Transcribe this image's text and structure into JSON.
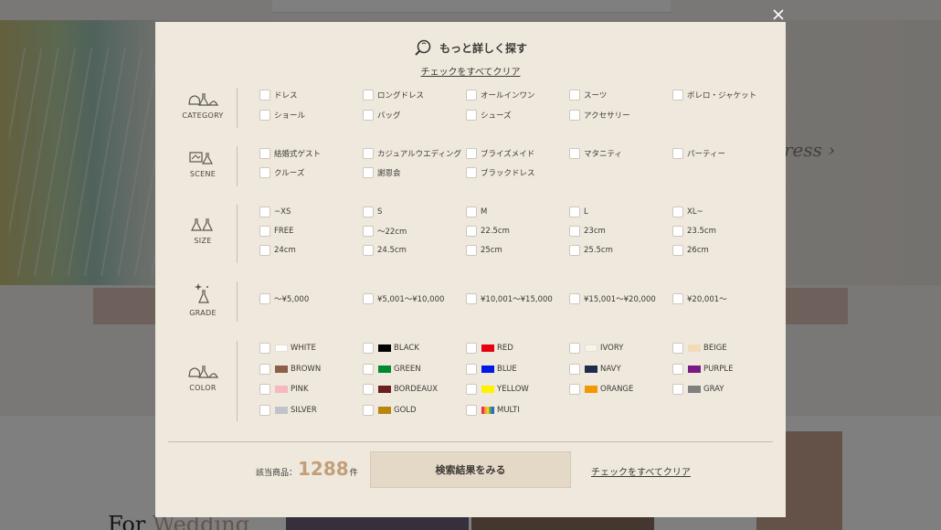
{
  "title": "もっと詳しく探す",
  "clear_all": "チェックをすべてクリア",
  "sections": {
    "category": {
      "label": "CATEGORY",
      "options": [
        "ドレス",
        "ロングドレス",
        "オールインワン",
        "スーツ",
        "ボレロ・ジャケット",
        "ショール",
        "バッグ",
        "シューズ",
        "アクセサリー"
      ]
    },
    "scene": {
      "label": "SCENE",
      "options": [
        "結婚式ゲスト",
        "カジュアルウエディング",
        "ブライズメイド",
        "マタニティ",
        "パーティー",
        "クルーズ",
        "謝恩会",
        "ブラックドレス"
      ]
    },
    "size": {
      "label": "SIZE",
      "options": [
        "~XS",
        "S",
        "M",
        "L",
        "XL~",
        "FREE",
        "～22cm",
        "22.5cm",
        "23cm",
        "23.5cm",
        "24cm",
        "24.5cm",
        "25cm",
        "25.5cm",
        "26cm"
      ]
    },
    "grade": {
      "label": "GRADE",
      "options": [
        "～¥5,000",
        "¥5,001～¥10,000",
        "¥10,001～¥15,000",
        "¥15,001～¥20,000",
        "¥20,001～"
      ]
    },
    "color": {
      "label": "COLOR",
      "options": [
        {
          "label": "WHITE",
          "color": "#ffffff"
        },
        {
          "label": "BLACK",
          "color": "#000000"
        },
        {
          "label": "RED",
          "color": "#e60012"
        },
        {
          "label": "IVORY",
          "color": "#f8f4e8"
        },
        {
          "label": "BEIGE",
          "color": "#f1dbb8"
        },
        {
          "label": "BROWN",
          "color": "#8b6046"
        },
        {
          "label": "GREEN",
          "color": "#008a2e"
        },
        {
          "label": "BLUE",
          "color": "#0019e6"
        },
        {
          "label": "NAVY",
          "color": "#1d2c4c"
        },
        {
          "label": "PURPLE",
          "color": "#7b1a84"
        },
        {
          "label": "PINK",
          "color": "#f7b7c3"
        },
        {
          "label": "BORDEAUX",
          "color": "#6b1f22"
        },
        {
          "label": "YELLOW",
          "color": "#fff200"
        },
        {
          "label": "ORANGE",
          "color": "#f39800"
        },
        {
          "label": "GRAY",
          "color": "#808080"
        },
        {
          "label": "SILVER",
          "color": "#c0c4c8"
        },
        {
          "label": "GOLD",
          "color": "#b8860b"
        },
        {
          "label": "MULTI",
          "color": "multi"
        }
      ]
    }
  },
  "footer": {
    "count_prefix": "該当商品：",
    "count": "1288",
    "count_suffix": "件",
    "search_button": "検索結果をみる",
    "clear_all": "チェックをすべてクリア"
  },
  "background": {
    "heading_a": "For ",
    "heading_b": "Wedding",
    "script": "ress ›"
  }
}
